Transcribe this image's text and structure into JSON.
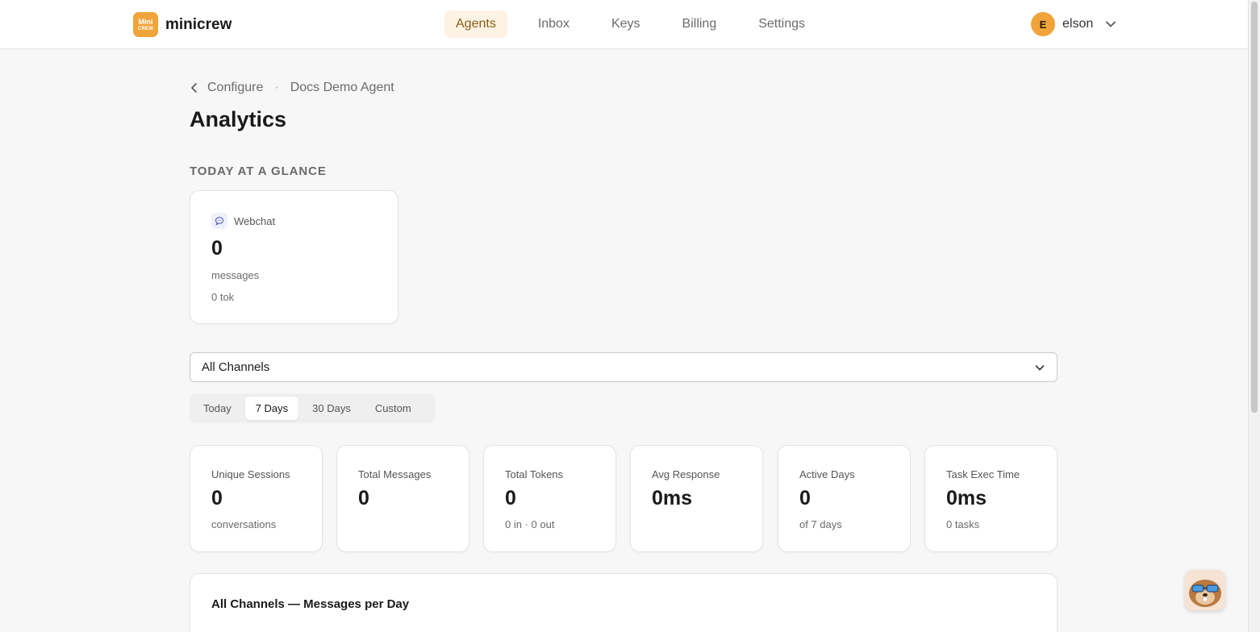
{
  "brand": {
    "name": "minicrew",
    "logo_line1": "Mini",
    "logo_line2": "CREW"
  },
  "nav": {
    "items": [
      "Agents",
      "Inbox",
      "Keys",
      "Billing",
      "Settings"
    ],
    "active": "Agents"
  },
  "user": {
    "initial": "E",
    "name": "elson"
  },
  "breadcrumb": {
    "back": "Configure",
    "separator": "·",
    "current": "Docs Demo Agent"
  },
  "page": {
    "title": "Analytics"
  },
  "glance": {
    "section_label": "TODAY AT A GLANCE",
    "channel": "Webchat",
    "value": "0",
    "unit": "messages",
    "tokens": "0 tok"
  },
  "filters": {
    "channel_select": "All Channels",
    "ranges": [
      "Today",
      "7 Days",
      "30 Days",
      "Custom"
    ],
    "active_range": "7 Days"
  },
  "stats": [
    {
      "label": "Unique Sessions",
      "value": "0",
      "sub": "conversations"
    },
    {
      "label": "Total Messages",
      "value": "0",
      "sub": ""
    },
    {
      "label": "Total Tokens",
      "value": "0",
      "sub": "0 in · 0 out"
    },
    {
      "label": "Avg Response",
      "value": "0ms",
      "sub": ""
    },
    {
      "label": "Active Days",
      "value": "0",
      "sub": "of 7 days"
    },
    {
      "label": "Task Exec Time",
      "value": "0ms",
      "sub": "0 tasks"
    }
  ],
  "chart_section": {
    "title": "All Channels — Messages per Day"
  },
  "colors": {
    "accent": "#f0a43a",
    "active_nav_bg": "#fdf3e4",
    "active_nav_text": "#8a5b18"
  }
}
